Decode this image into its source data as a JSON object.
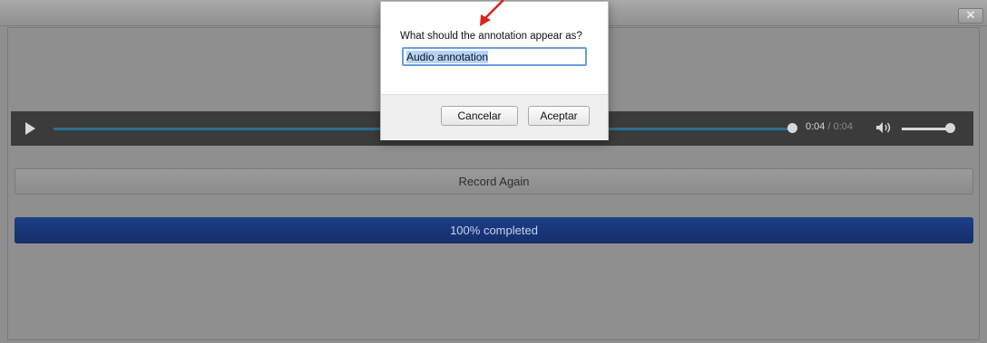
{
  "window": {
    "close_label": "✕"
  },
  "player": {
    "current_time": "0:04",
    "separator": " / ",
    "duration": "0:04",
    "progress_fraction": 1.0,
    "volume_fraction": 0.9
  },
  "record": {
    "label": "Record Again"
  },
  "progress": {
    "label": "100% completed",
    "fraction": 1.0
  },
  "dialog": {
    "prompt": "What should the annotation appear as?",
    "input_value": "Audio annotation",
    "cancel_label": "Cancelar",
    "ok_label": "Aceptar"
  },
  "colors": {
    "accent": "#2b6f94",
    "progress": "#1b3f88",
    "annotation_arrow": "#e02020"
  },
  "icons": {
    "play": "play-icon",
    "volume": "volume-icon",
    "close": "close-icon"
  }
}
